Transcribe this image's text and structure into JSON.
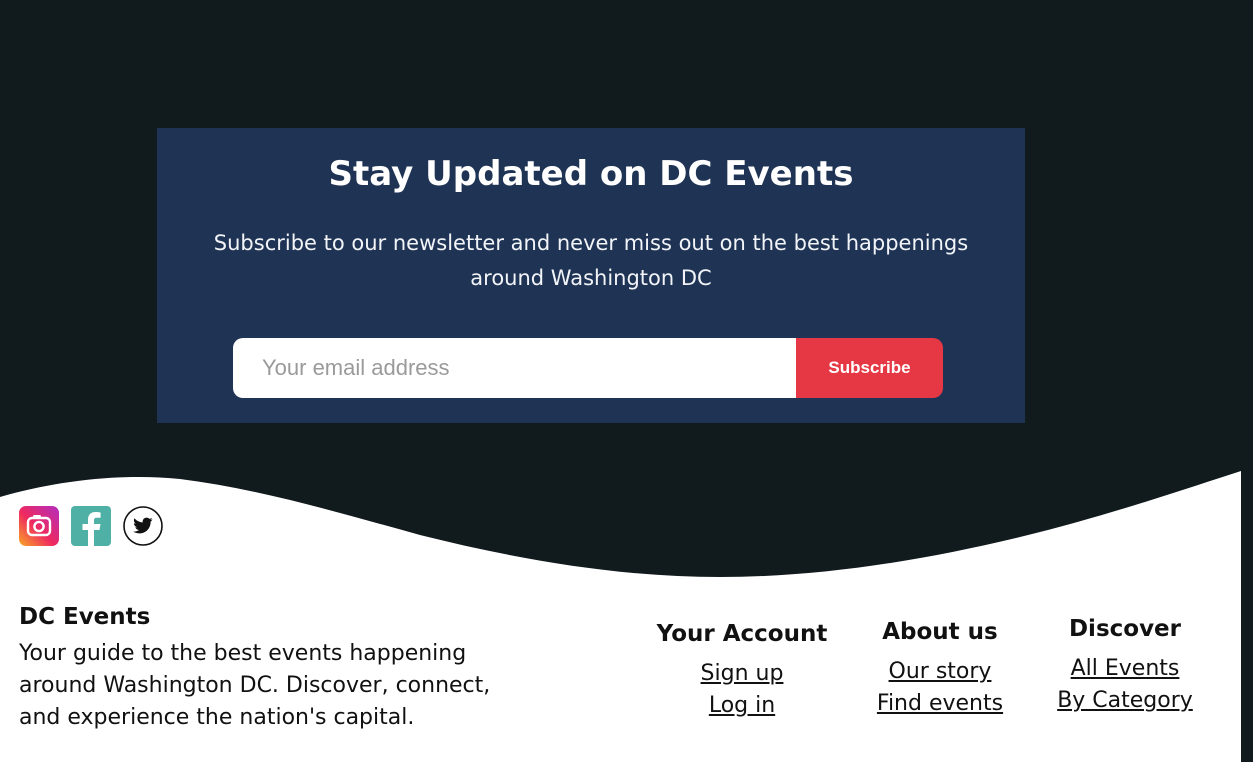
{
  "newsletter": {
    "title": "Stay Updated on DC Events",
    "subtitle": "Subscribe to our newsletter and never miss out on the best happenings around Washington DC",
    "email_placeholder": "Your email address",
    "button_label": "Subscribe",
    "colors": {
      "page_background": "#111a1d",
      "card_background": "#1f3455",
      "button_background": "#e53844"
    }
  },
  "footer": {
    "social": [
      {
        "icon": "instagram-icon"
      },
      {
        "icon": "facebook-icon"
      },
      {
        "icon": "twitter-icon"
      }
    ],
    "brand": {
      "name": "DC Events",
      "description": "Your guide to the best events happening around Washington DC. Discover, connect, and experience the nation's capital."
    },
    "columns": {
      "account": {
        "title": "Your Account",
        "links": [
          "Sign up",
          "Log in"
        ]
      },
      "about": {
        "title": "About us",
        "links": [
          "Our story",
          "Find events"
        ]
      },
      "discover": {
        "title": "Discover",
        "links": [
          "All Events",
          "By Category"
        ]
      }
    }
  }
}
